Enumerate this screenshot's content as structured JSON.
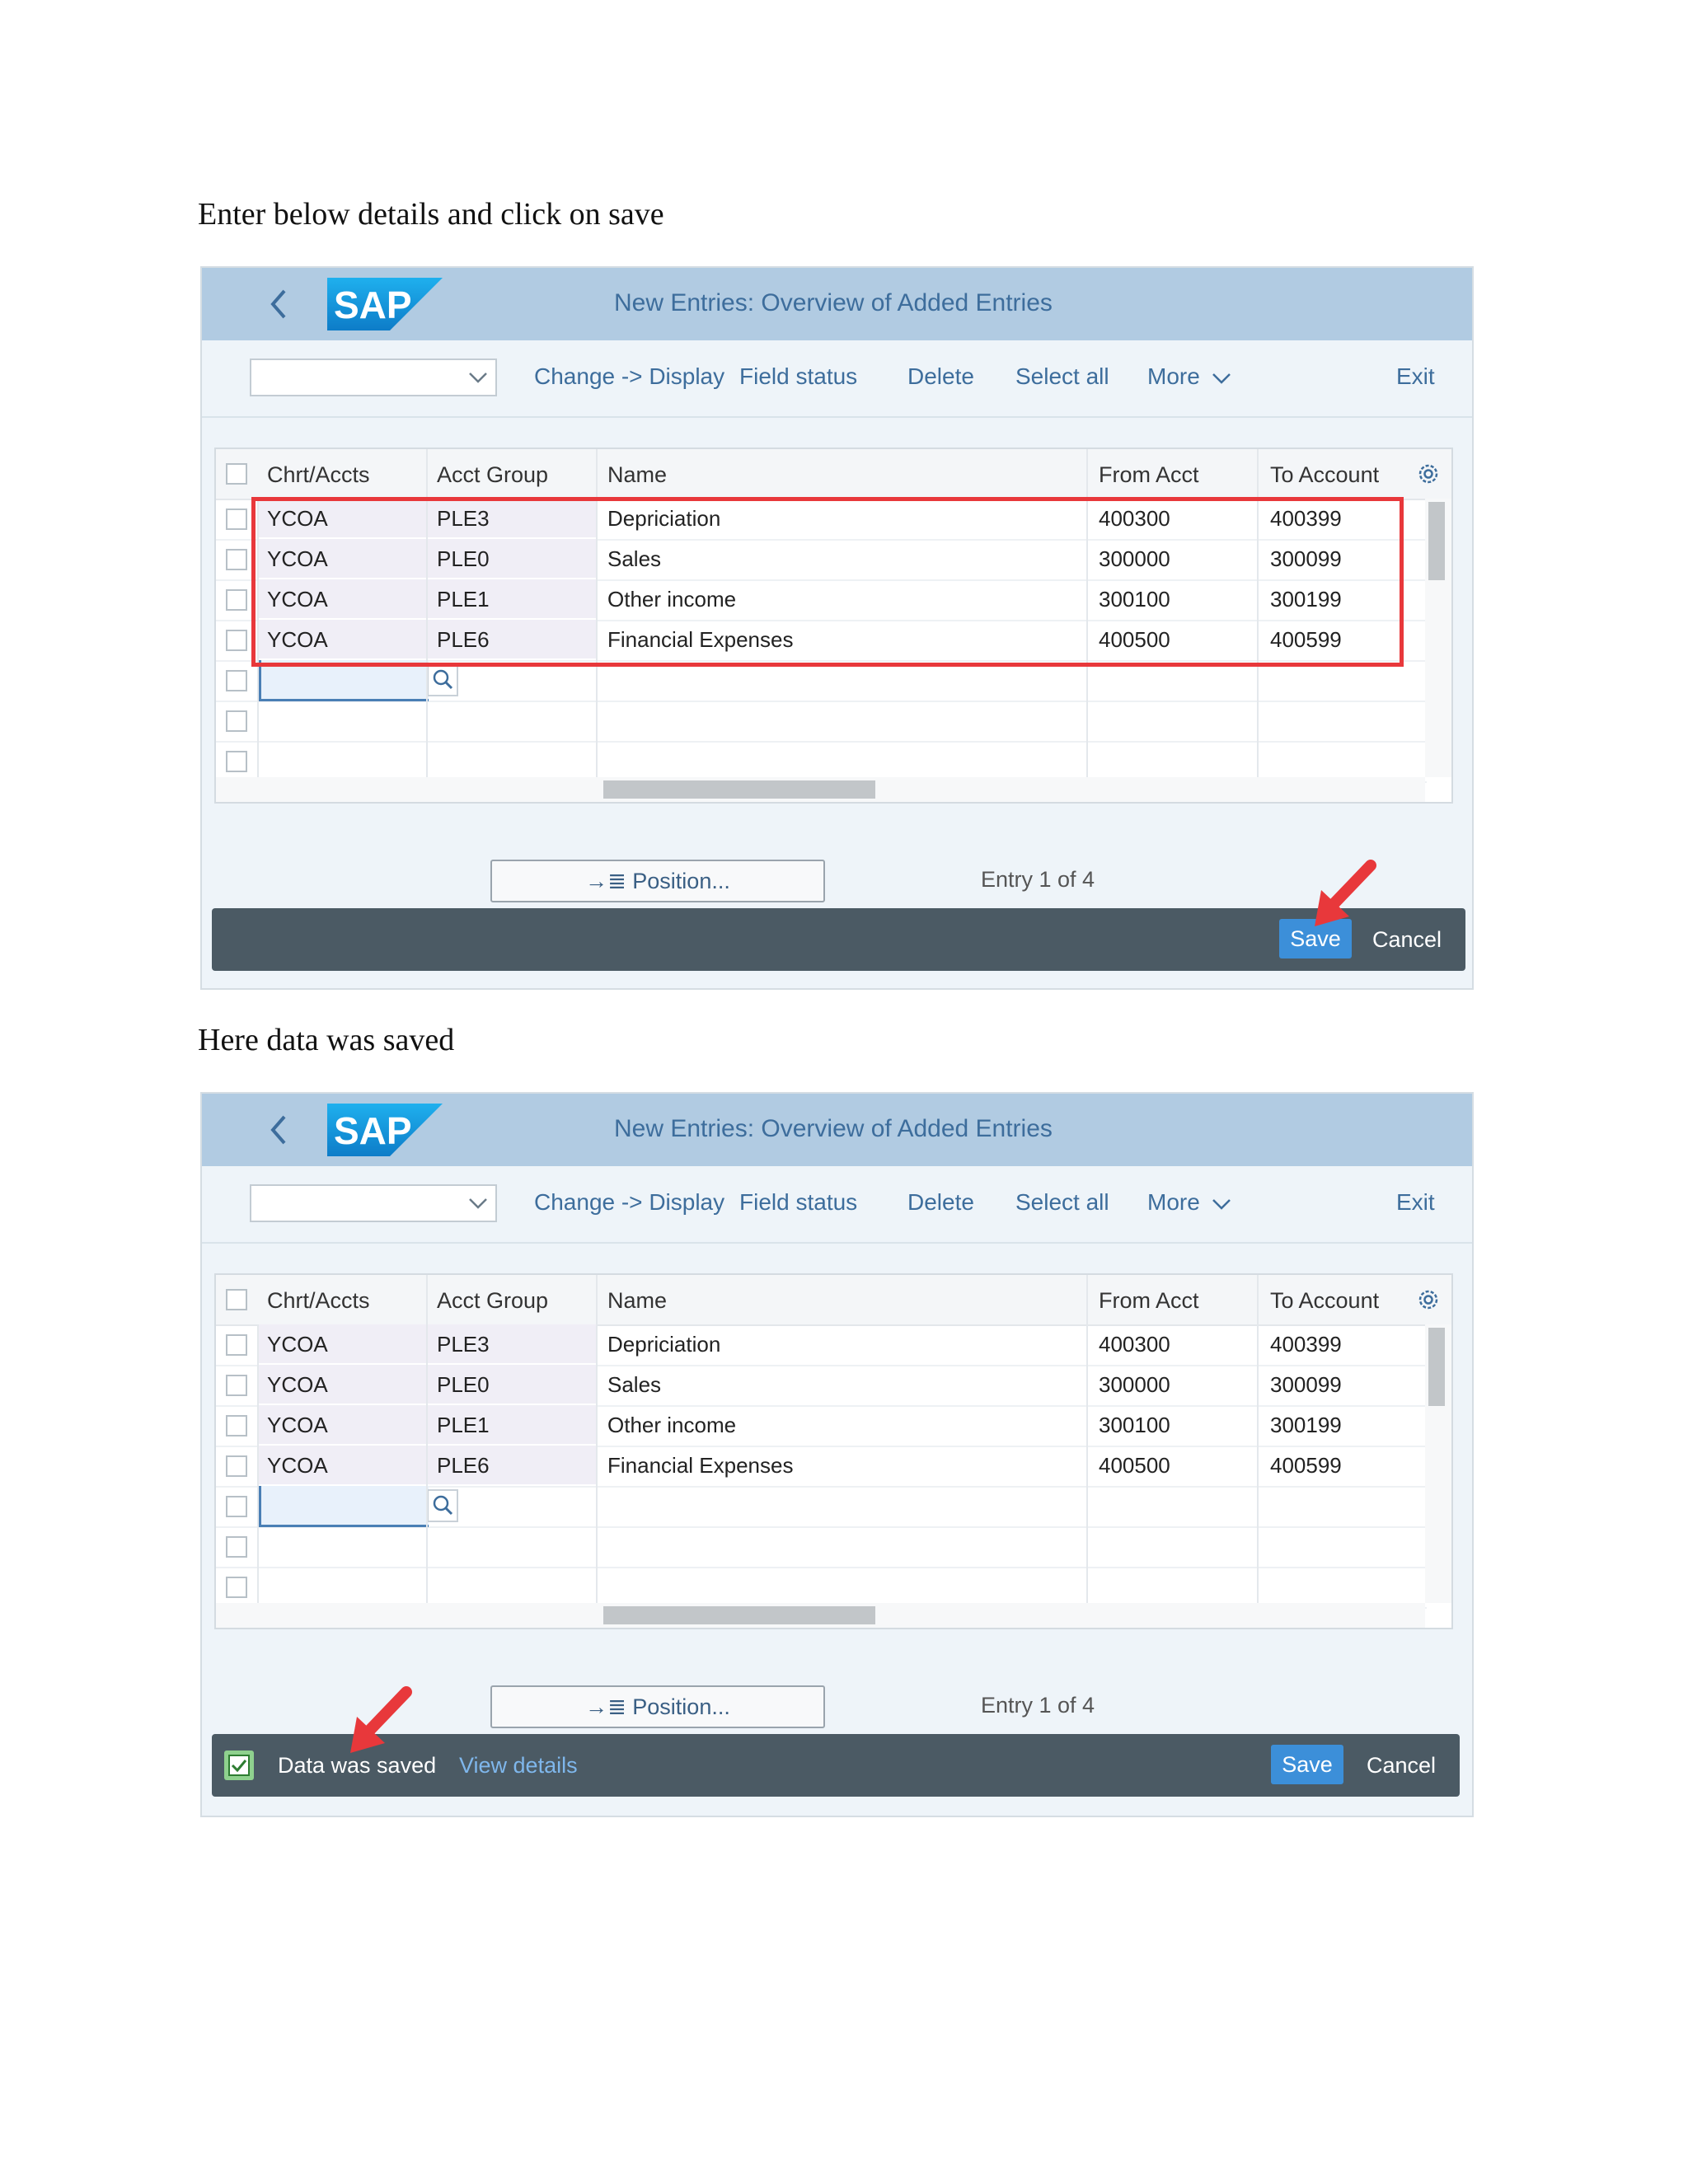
{
  "doc": {
    "instruction_1": "Enter below details and click on save",
    "instruction_2": "Here data was saved"
  },
  "window": {
    "title": "New Entries: Overview of Added Entries",
    "logo_text": "SAP"
  },
  "toolbar": {
    "change_display": "Change -> Display",
    "field_status": "Field status",
    "delete": "Delete",
    "select_all": "Select all",
    "more": "More",
    "exit": "Exit"
  },
  "table": {
    "headers": [
      "Chrt/Accts",
      "Acct Group",
      "Name",
      "From Acct",
      "To Account"
    ],
    "rows": [
      [
        "YCOA",
        "PLE3",
        "Depriciation",
        "400300",
        "400399"
      ],
      [
        "YCOA",
        "PLE0",
        "Sales",
        "300000",
        "300099"
      ],
      [
        "YCOA",
        "PLE1",
        "Other income",
        "300100",
        "300199"
      ],
      [
        "YCOA",
        "PLE6",
        "Financial Expenses",
        "400500",
        "400599"
      ]
    ],
    "empty_rows": 3
  },
  "footer_area": {
    "position_button": "Position...",
    "entry_info": "Entry 1 of 4",
    "save": "Save",
    "cancel": "Cancel",
    "saved_message": "Data was saved",
    "view_details": "View details"
  },
  "colors": {
    "titlebar": "#b1cbe2",
    "footer": "#4b5a64",
    "save": "#3c8fd9",
    "highlight": "#e8383b",
    "link": "#3d6d9c"
  }
}
